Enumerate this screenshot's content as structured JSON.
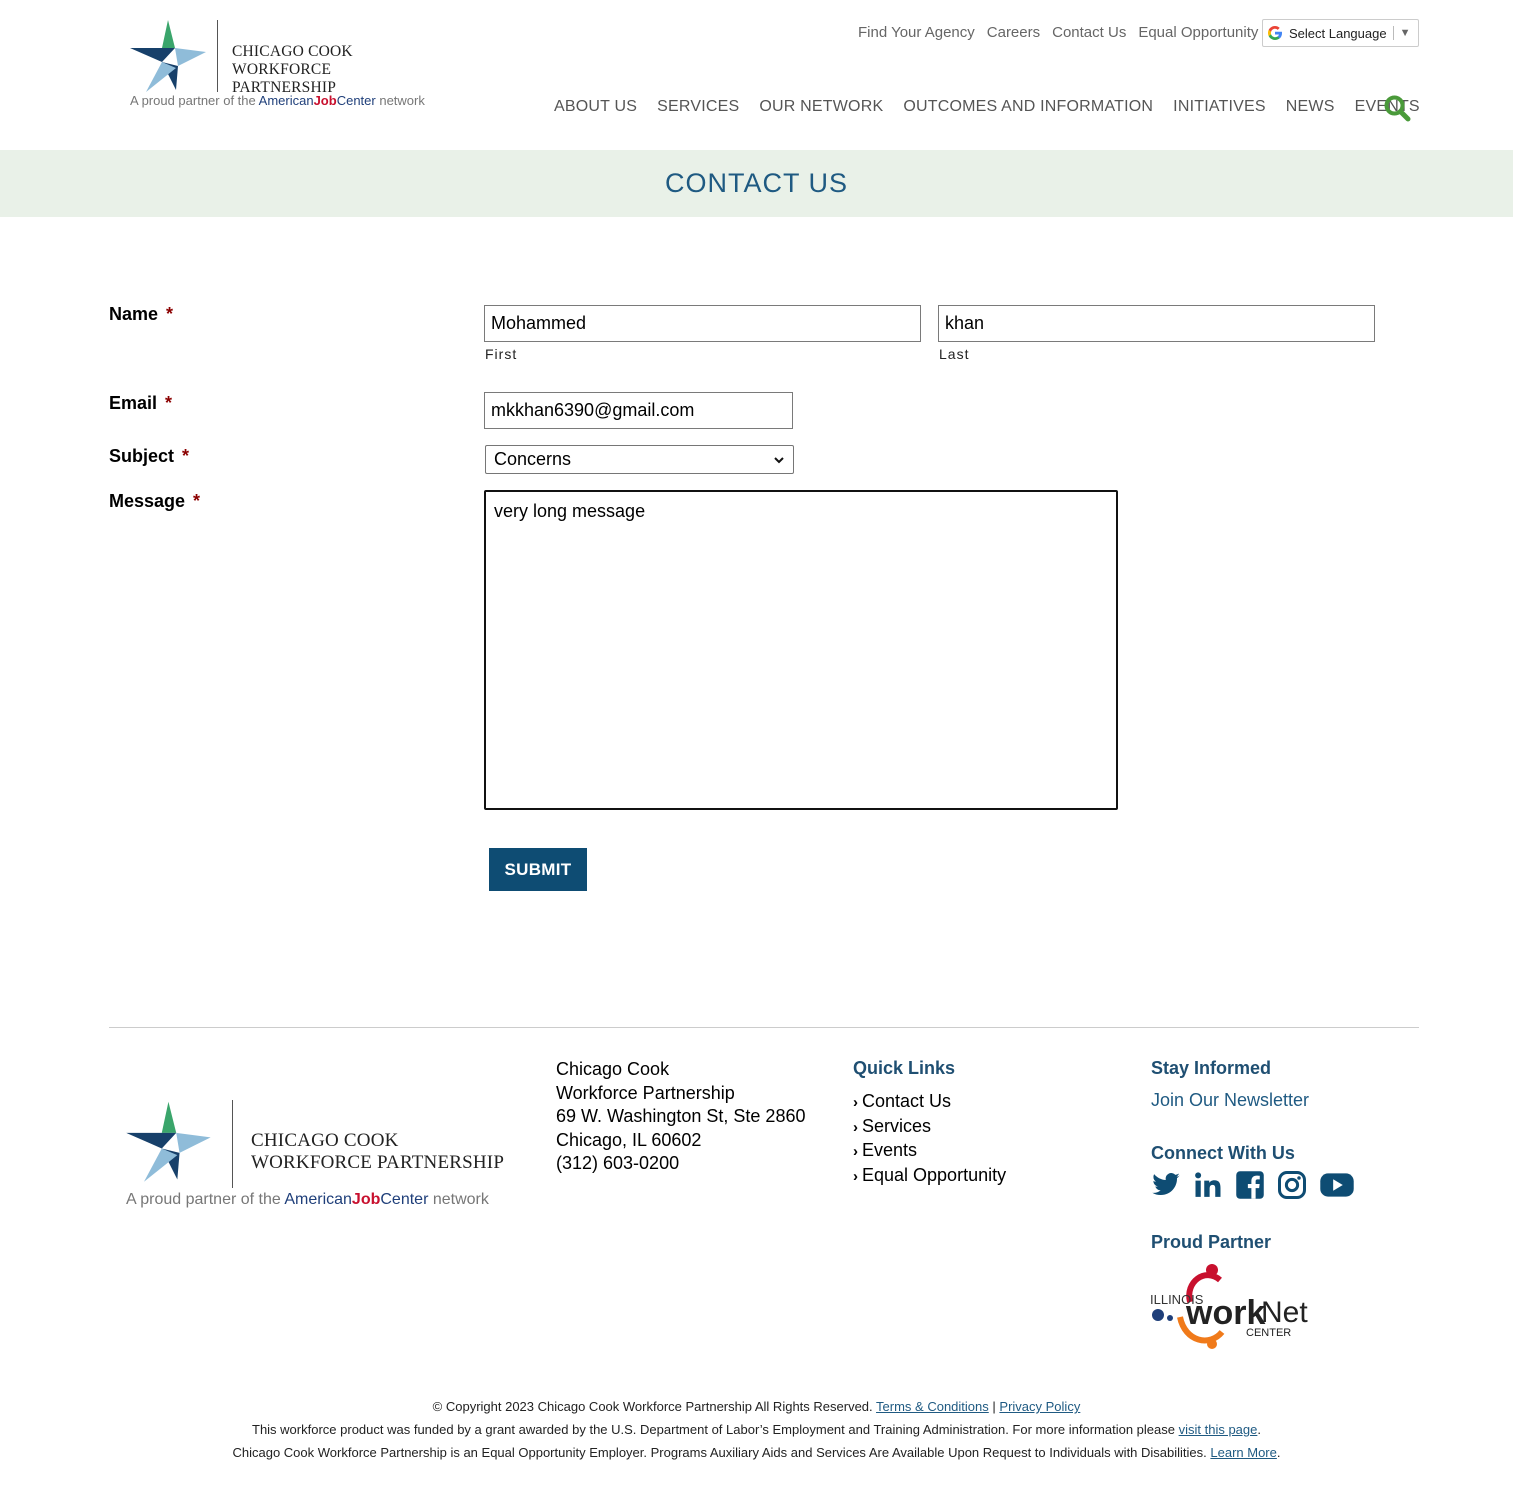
{
  "header": {
    "logo_line1": "CHICAGO COOK",
    "logo_line2": "WORKFORCE PARTNERSHIP",
    "logo_tag_prefix": "A proud partner of the ",
    "logo_tag_american": "American",
    "logo_tag_job": "Job",
    "logo_tag_center": "Center",
    "logo_tag_suffix": " network",
    "util_links": [
      "Find Your Agency",
      "Careers",
      "Contact Us",
      "Equal Opportunity"
    ],
    "language_label": "Select Language",
    "nav": [
      "ABOUT US",
      "SERVICES",
      "OUR NETWORK",
      "OUTCOMES AND INFORMATION",
      "INITIATIVES",
      "NEWS",
      "EVENTS"
    ]
  },
  "banner": {
    "title": "CONTACT US"
  },
  "form": {
    "name_label": "Name",
    "required_mark": "*",
    "first_value": "Mohammed",
    "first_sublabel": "First",
    "last_value": "khan",
    "last_sublabel": "Last",
    "email_label": "Email",
    "email_value": "mkkhan6390@gmail.com",
    "subject_label": "Subject",
    "subject_value": "Concerns",
    "message_label": "Message",
    "message_value": "very long message",
    "submit_label": "SUBMIT"
  },
  "footer": {
    "address": [
      "Chicago Cook",
      "Workforce Partnership",
      "69 W. Washington St, Ste 2860",
      "Chicago, IL 60602",
      "(312) 603-0200"
    ],
    "quick_links_title": "Quick Links",
    "quick_links": [
      "Contact Us",
      "Services",
      "Events",
      "Equal Opportunity"
    ],
    "stay_informed_title": "Stay Informed",
    "newsletter_link": "Join Our Newsletter",
    "connect_title": "Connect With Us",
    "social_icons": [
      "twitter-icon",
      "linkedin-icon",
      "facebook-icon",
      "instagram-icon",
      "youtube-icon"
    ],
    "proud_partner_title": "Proud Partner",
    "worknet_illinois": "ILLINOIS",
    "worknet_work": "work",
    "worknet_net": "Net",
    "worknet_center": "CENTER",
    "copyright": "© Copyright 2023 Chicago Cook Workforce Partnership All Rights Reserved.",
    "terms_link": "Terms & Conditions",
    "divider": "|",
    "privacy_link": "Privacy Policy",
    "funding_text": "This workforce product was funded by a grant awarded by the U.S. Department of Labor’s Employment and Training Administration. For more information please",
    "funding_link": "visit this page",
    "eo_text": "Chicago Cook Workforce Partnership is an Equal Opportunity Employer. Programs Auxiliary Aids and Services Are Available Upon Request to Individuals with Disabilities.",
    "eo_link": "Learn More",
    "period": "."
  },
  "colors": {
    "brand_blue": "#1f5a82",
    "banner_bg": "#e9f1e8",
    "submit_bg": "#0e4c73",
    "search_green": "#4a9a3a"
  }
}
